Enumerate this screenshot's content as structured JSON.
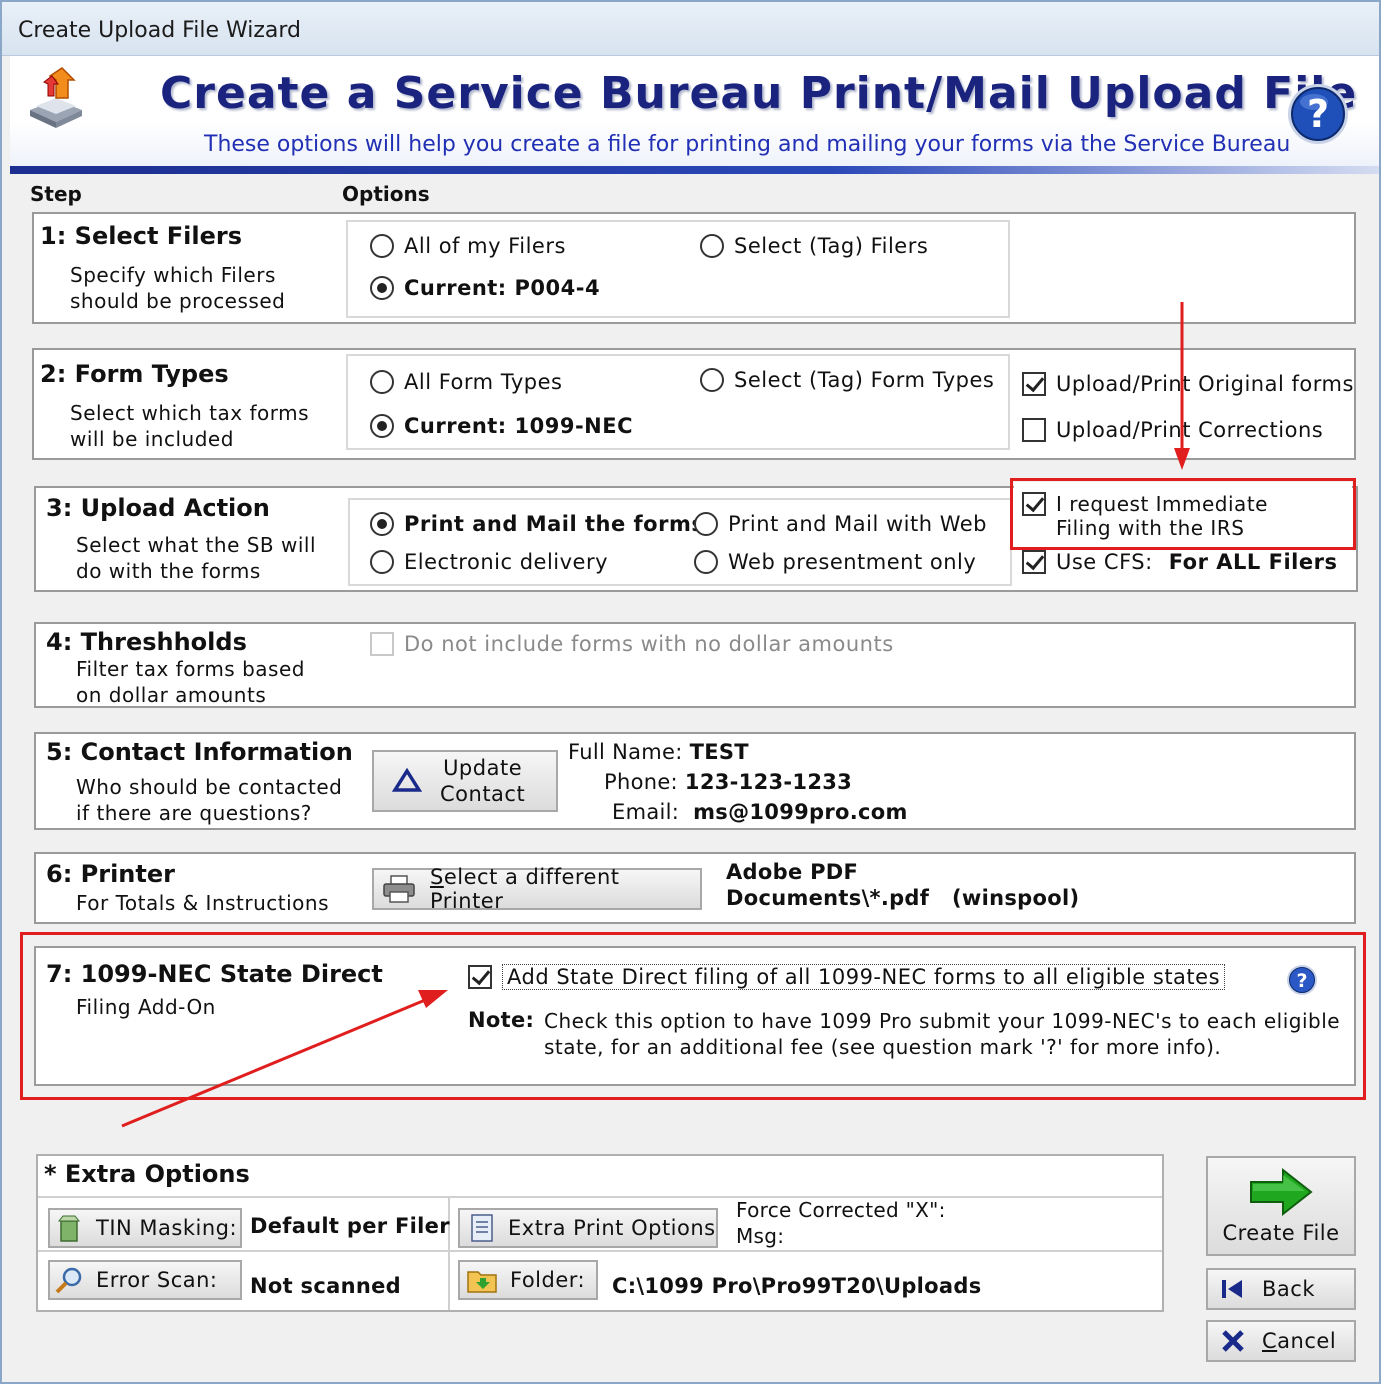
{
  "window": {
    "title": "Create Upload File Wizard"
  },
  "banner": {
    "title": "Create a Service Bureau Print/Mail Upload File",
    "subtitle": "These options will help you create a file for printing and mailing your forms via the Service Bureau"
  },
  "columns": {
    "step": "Step",
    "options": "Options"
  },
  "step1": {
    "title": "1: Select Filers",
    "desc": "Specify which Filers\nshould be processed",
    "options": [
      {
        "label": "All of my Filers",
        "selected": false
      },
      {
        "label": "Select (Tag) Filers",
        "selected": false
      },
      {
        "label": "Current: P004-4",
        "selected": true
      }
    ]
  },
  "step2": {
    "title": "2: Form Types",
    "desc": "Select which tax forms\nwill be included",
    "options": [
      {
        "label": "All Form Types",
        "selected": false
      },
      {
        "label": "Select (Tag) Form Types",
        "selected": false
      },
      {
        "label": "Current: 1099-NEC",
        "selected": true
      }
    ],
    "checks": [
      {
        "label": "Upload/Print Original forms",
        "checked": true
      },
      {
        "label": "Upload/Print Corrections",
        "checked": false
      }
    ]
  },
  "step3": {
    "title": "3: Upload Action",
    "desc": "Select what the SB will\ndo with the forms",
    "options": [
      {
        "label": "Print and Mail the forms",
        "selected": true
      },
      {
        "label": "Print and Mail with Web",
        "selected": false
      },
      {
        "label": "Electronic delivery",
        "selected": false
      },
      {
        "label": "Web presentment only",
        "selected": false
      }
    ],
    "immediate_label": "I request Immediate\nFiling with the IRS",
    "immediate_checked": true,
    "cfs_label": "Use CFS:",
    "cfs_value": "For ALL Filers",
    "cfs_checked": true
  },
  "step4": {
    "title": "4: Threshholds",
    "desc": "Filter tax forms based\non dollar amounts",
    "check_label": "Do not include forms with no dollar amounts",
    "checked": false
  },
  "step5": {
    "title": "5: Contact Information",
    "desc": "Who should be contacted\nif there are questions?",
    "button": "Update\nContact",
    "fullname_label": "Full Name:",
    "fullname": "TEST",
    "phone_label": "Phone:",
    "phone": "123-123-1233",
    "email_label": "Email:",
    "email": "ms@1099pro.com"
  },
  "step6": {
    "title": "6: Printer",
    "desc": "For Totals & Instructions",
    "button_prefix": "S",
    "button_rest": "elect a different Printer",
    "printer_line1": "Adobe PDF",
    "printer_line2": "Documents\\*.pdf   (winspool)"
  },
  "step7": {
    "title": "7: 1099-NEC State Direct",
    "desc": "Filing Add-On",
    "check_label": "Add State Direct filing of all 1099-NEC forms to all eligible states",
    "checked": true,
    "note_label": "Note:",
    "note_text": "Check this option to have 1099 Pro submit your 1099-NEC's to each eligible\nstate, for an additional fee (see question mark '?' for more info)."
  },
  "extra": {
    "title": "* Extra Options",
    "tin_button": "TIN Masking:",
    "tin_value": "Default per Filer",
    "print_button": "Extra Print Options",
    "force_label": "Force Corrected \"X\":",
    "msg_label": "Msg:",
    "scan_button": "Error Scan:",
    "scan_value": "Not scanned",
    "folder_button": "Folder:",
    "folder_value": "C:\\1099 Pro\\Pro99T20\\Uploads"
  },
  "actions": {
    "create": "Create File",
    "back": "Back",
    "cancel_prefix": "C",
    "cancel_rest": "ancel"
  },
  "colors": {
    "banner_title": "#1a237e",
    "annotation_red": "#e01e1e",
    "create_arrow": "#1fa81f"
  }
}
